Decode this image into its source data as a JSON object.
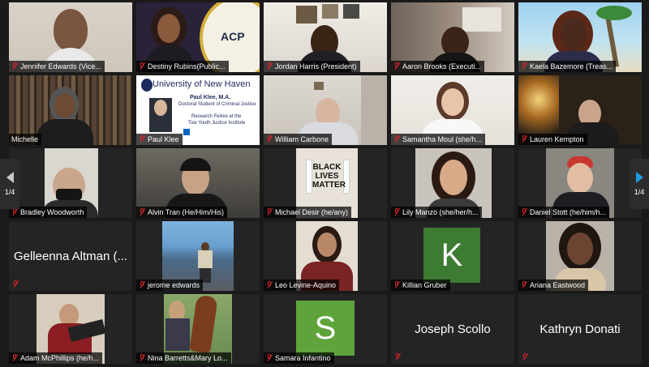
{
  "participants": [
    {
      "name": "Jennifer Edwards (Vice..."
    },
    {
      "name": "Destiny Rubins(Public..."
    },
    {
      "name": "Jordan Harris (President)"
    },
    {
      "name": "Aaron Brooks (Executi..."
    },
    {
      "name": "Kaela Bazemore (Treas..."
    },
    {
      "name": "Michelle"
    },
    {
      "name": "Paul Klee"
    },
    {
      "name": "William Carbone"
    },
    {
      "name": "Samantha Moul (she/h..."
    },
    {
      "name": "Lauren Kempton"
    },
    {
      "name": "Bradley Woodworth"
    },
    {
      "name": "Alvin Tran (He/Him/His)"
    },
    {
      "name": "Michael Desir (he/any)"
    },
    {
      "name": "Lily Manzo (she/her/h..."
    },
    {
      "name": "Daniel Stott (he/him/h..."
    },
    {
      "name": "Gelleenna Altman (..."
    },
    {
      "name": "jerome edwards"
    },
    {
      "name": "Leo Levine-Aquino"
    },
    {
      "name": "Killian Gruber",
      "initial": "K"
    },
    {
      "name": "Ariana Eastwood"
    },
    {
      "name": "Adam McPhillips (he/h..."
    },
    {
      "name": "Nina Barretts&Mary Lo..."
    },
    {
      "name": "Samara Infantino",
      "initial": "S"
    },
    {
      "name": "Joseph Scollo"
    },
    {
      "name": "Kathryn Donati"
    }
  ],
  "pager": {
    "left": "1/4",
    "right": "1/4"
  },
  "backgrounds": {
    "naacp": "ACP",
    "univ": "University of New Haven",
    "univ_name": "Paul Klee, M.A.",
    "univ_role": "Doctoral Student of Criminal Justice",
    "univ_fellow": "Research Fellow at the",
    "univ_inst": "Tow Youth Justice Institute",
    "blm_1": "BLACK",
    "blm_2": "LIVES",
    "blm_3": "MATTER"
  },
  "colors": {
    "active_border": "#c8d64a",
    "muted_red": "#e0242c",
    "pager_blue": "#1f9ae0"
  }
}
